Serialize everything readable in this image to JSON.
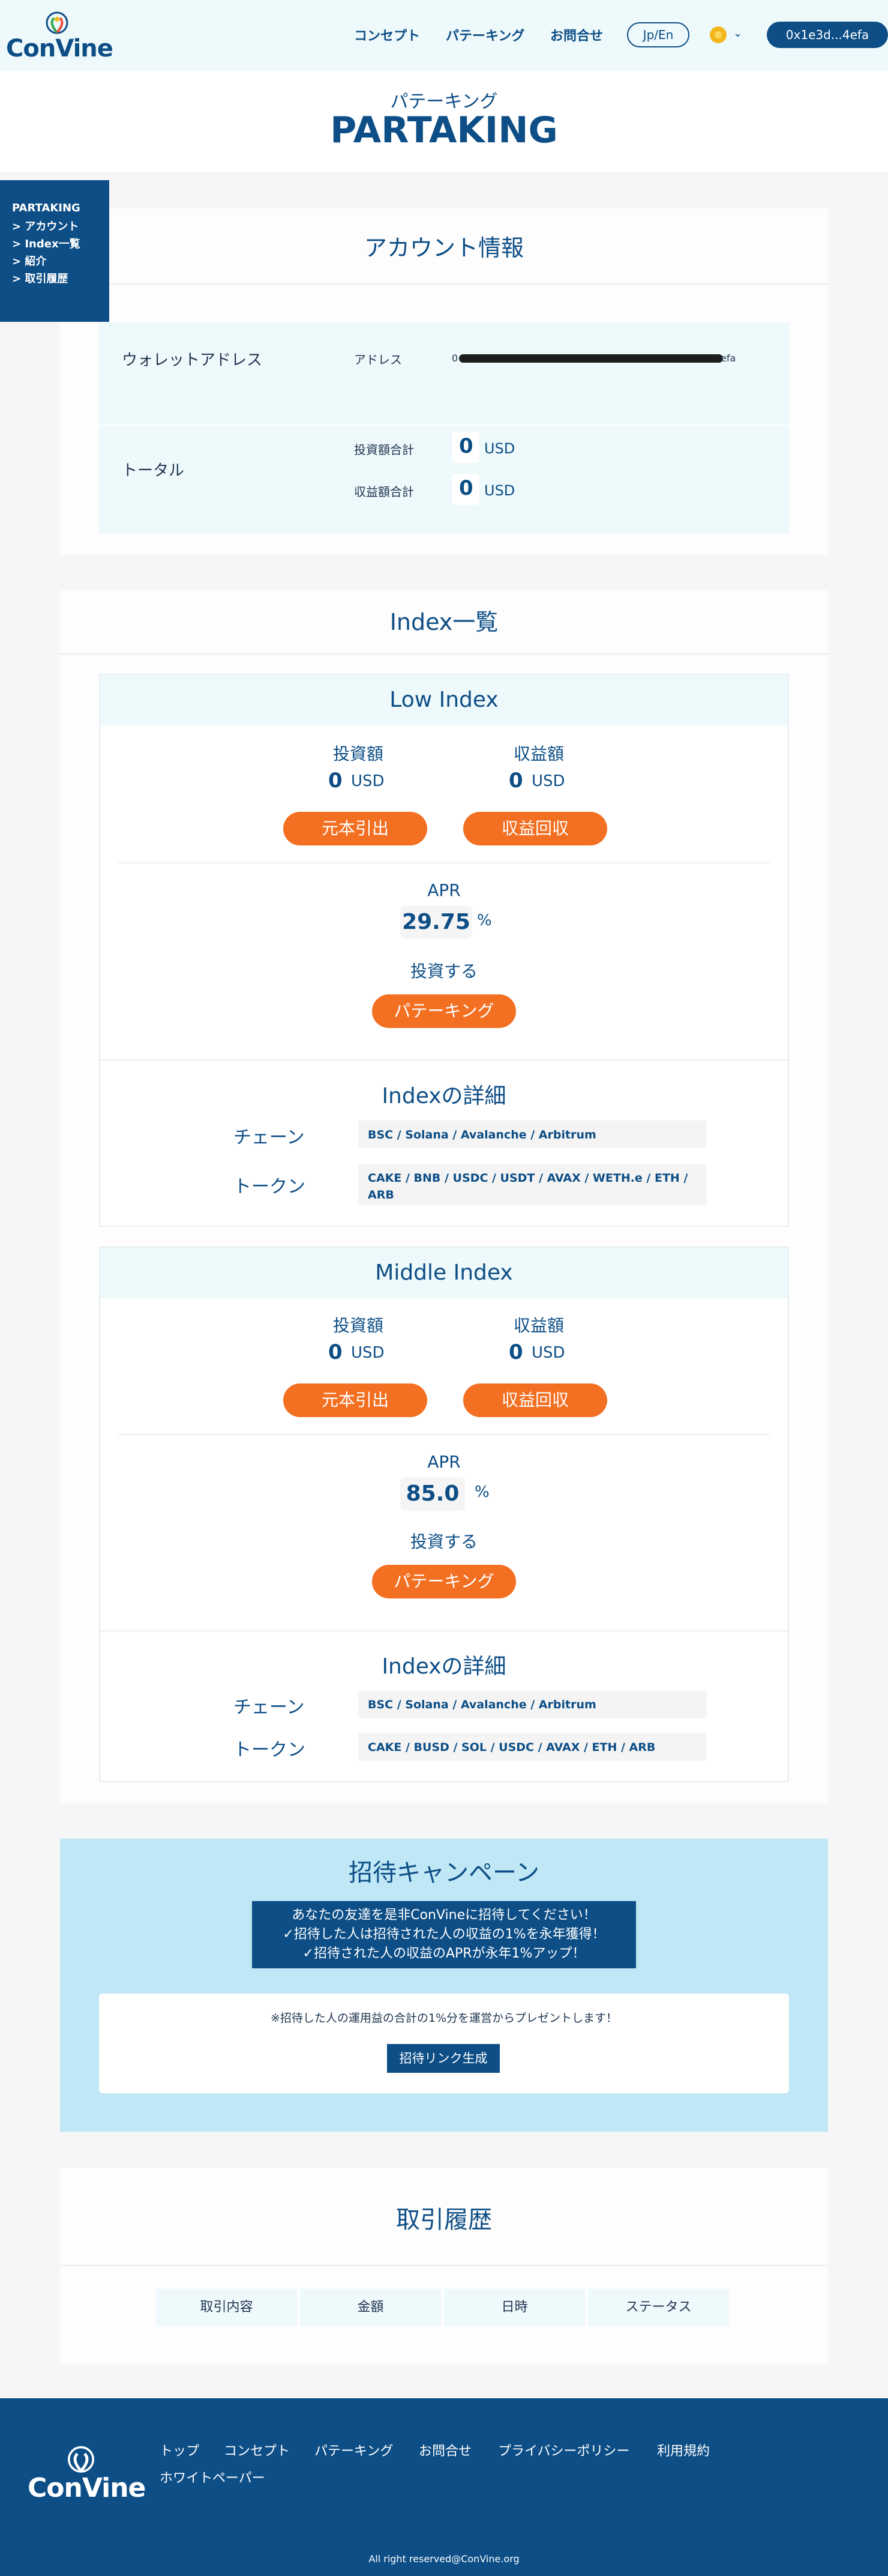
{
  "header": {
    "brand": "ConVine",
    "nav": [
      "コンセプト",
      "パテーキング",
      "お問合せ"
    ],
    "lang": "Jp/En",
    "wallet": "0x1e3d...4efa"
  },
  "page": {
    "kana": "パテーキング",
    "title": "PARTAKING"
  },
  "sidenav": {
    "title": "PARTAKING",
    "items": [
      "> アカウント",
      "> Index一覧",
      "> 紹介",
      "> 取引履歴"
    ]
  },
  "account": {
    "title": "アカウント情報",
    "wallet_label": "ウォレットアドレス",
    "address_label": "アドレス",
    "address_prefix": "0",
    "address_suffix": "efa",
    "total_label": "トータル",
    "invest_label": "投資額合計",
    "invest_value": "0",
    "profit_label": "収益額合計",
    "profit_value": "0",
    "unit": "USD"
  },
  "index_list": {
    "title": "Index一覧",
    "indices": [
      {
        "name": "Low Index",
        "invest_label": "投資額",
        "invest_value": "0",
        "profit_label": "収益額",
        "profit_value": "0",
        "unit": "USD",
        "withdraw_btn": "元本引出",
        "collect_btn": "収益回収",
        "apr_label": "APR",
        "apr_value": "29.75",
        "apr_unit": "%",
        "invest_cta": "投資する",
        "stake_btn": "パテーキング",
        "detail_title": "Indexの詳細",
        "chain_label": "チェーン",
        "chain_value": "BSC / Solana / Avalanche / Arbitrum",
        "token_label": "トークン",
        "token_value": "CAKE / BNB / USDC / USDT / AVAX / WETH.e / ETH / ARB"
      },
      {
        "name": "Middle Index",
        "invest_label": "投資額",
        "invest_value": "0",
        "profit_label": "収益額",
        "profit_value": "0",
        "unit": "USD",
        "withdraw_btn": "元本引出",
        "collect_btn": "収益回収",
        "apr_label": "APR",
        "apr_value": "85.0",
        "apr_unit": "%",
        "invest_cta": "投資する",
        "stake_btn": "パテーキング",
        "detail_title": "Indexの詳細",
        "chain_label": "チェーン",
        "chain_value": "BSC / Solana / Avalanche / Arbitrum",
        "token_label": "トークン",
        "token_value": "CAKE / BUSD / SOL / USDC / AVAX / ETH / ARB"
      }
    ]
  },
  "campaign": {
    "title": "招待キャンペーン",
    "lines": [
      "あなたの友達を是非ConVineに招待してください！",
      "✓招待した人は招待された人の収益の1%を永年獲得！",
      "✓招待された人の収益のAPRが永年1%アップ！"
    ],
    "note": "※招待した人の運用益の合計の1%分を運営からプレゼントします！",
    "button": "招待リンク生成"
  },
  "history": {
    "title": "取引履歴",
    "columns": [
      "取引内容",
      "金額",
      "日時",
      "ステータス"
    ]
  },
  "footer": {
    "brand": "ConVine",
    "links": [
      "トップ",
      "コンセプト",
      "パテーキング",
      "お問合せ",
      "プライバシーポリシー",
      "利用規約",
      "ホワイトペーパー"
    ],
    "copyright": "All right reserved@ConVine.org"
  },
  "colors": {
    "navy": "#0d4e86",
    "orange": "#f36f21",
    "light_cyan": "#eef9fb",
    "campaign_bg": "#bfe7f6"
  }
}
